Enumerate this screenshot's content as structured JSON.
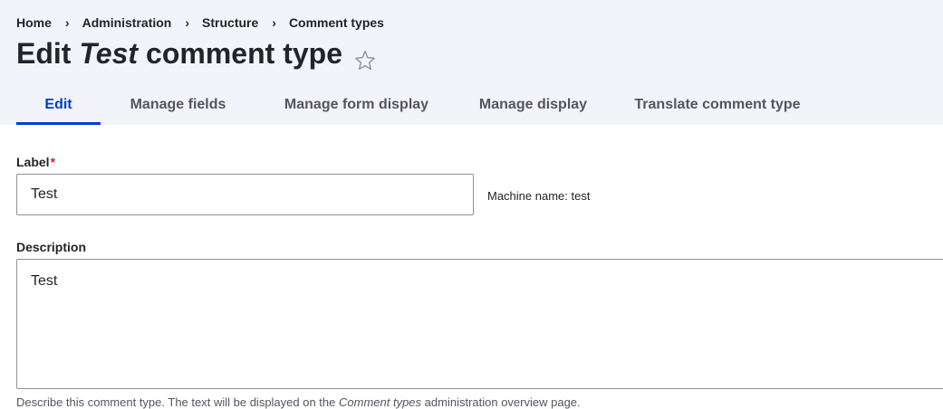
{
  "breadcrumb": {
    "items": [
      "Home",
      "Administration",
      "Structure",
      "Comment types"
    ],
    "separator": "›"
  },
  "page_title": {
    "prefix": "Edit",
    "emphasis": "Test",
    "suffix": "comment type",
    "favorite_icon": "star-outline-icon"
  },
  "tabs": [
    {
      "label": "Edit",
      "active": true
    },
    {
      "label": "Manage fields",
      "active": false
    },
    {
      "label": "Manage form display",
      "active": false
    },
    {
      "label": "Manage display",
      "active": false
    },
    {
      "label": "Translate comment type",
      "active": false
    }
  ],
  "form": {
    "label_field": {
      "label": "Label",
      "required_marker": "*",
      "value": "Test",
      "machine_name": "Machine name: test"
    },
    "description_field": {
      "label": "Description",
      "value": "Test",
      "help_prefix": "Describe this comment type. The text will be displayed on the ",
      "help_emphasis": "Comment types",
      "help_suffix": " administration overview page."
    }
  },
  "colors": {
    "header_bg": "#f3f4f9",
    "accent": "#003ecc",
    "required": "#d72222",
    "text": "#232429"
  }
}
